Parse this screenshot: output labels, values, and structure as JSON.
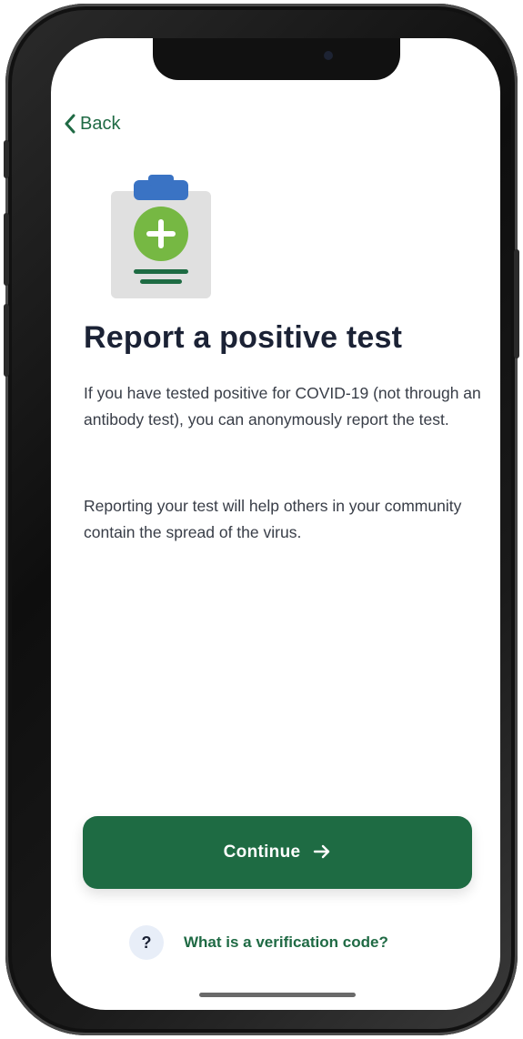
{
  "nav": {
    "back_label": "Back",
    "back_icon": "chevron-left-icon"
  },
  "hero": {
    "icon": "clipboard-plus-icon",
    "colors": {
      "clip": "#3a73c4",
      "board": "#e0e0e0",
      "plus_circle": "#76b843",
      "lines": "#1e6b43"
    }
  },
  "content": {
    "title": "Report a positive test",
    "paragraph1": "If you have tested positive for COVID-19 (not through an antibody test), you can anonymously report the test.",
    "paragraph2": "Reporting your test will help others in your community contain the spread of the virus."
  },
  "actions": {
    "continue_label": "Continue",
    "continue_icon": "arrow-right-icon",
    "help_badge": "?",
    "help_label": "What is a verification code?"
  },
  "colors": {
    "primary": "#1e6b43",
    "title": "#1b2235",
    "body_text": "#383d47",
    "help_badge_bg": "#e8eef8"
  }
}
